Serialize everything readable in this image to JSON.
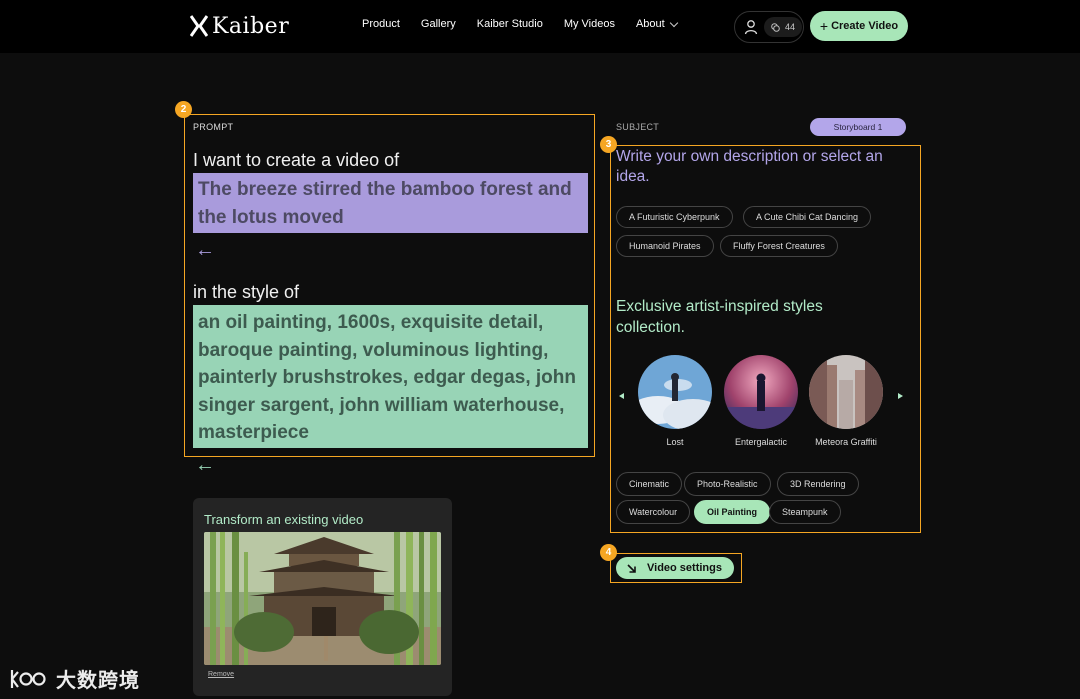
{
  "nav": {
    "brand": "Kaiber",
    "links": [
      "Product",
      "Gallery",
      "Kaiber Studio",
      "My Videos",
      "About"
    ],
    "credits": "44",
    "create_label": "Create Video"
  },
  "annotations": [
    "2",
    "3",
    "4"
  ],
  "prompt": {
    "label": "PROMPT",
    "lead": "I want to create a video of",
    "subject_text": "The breeze stirred the bamboo forest and the lotus moved",
    "style_lead": "in the style of",
    "style_text": "an oil painting, 1600s, exquisite detail, baroque painting, voluminous lighting, painterly brushstrokes, edgar degas, john singer sargent, john william waterhouse, masterpiece"
  },
  "transform": {
    "title": "Transform an existing video",
    "remove_label": "Remove"
  },
  "subject": {
    "label": "SUBJECT",
    "storyboard_label": "Storyboard 1",
    "description": "Write your own description or select an idea.",
    "ideas": [
      "A Futuristic Cyberpunk",
      "A Cute Chibi Cat Dancing",
      "Humanoid Pirates",
      "Fluffy Forest Creatures"
    ]
  },
  "styles": {
    "heading": "Exclusive artist-inspired styles collection.",
    "featured": [
      "Lost",
      "Entergalactic",
      "Meteora Graffiti"
    ],
    "tags": [
      "Cinematic",
      "Photo-Realistic",
      "3D Rendering",
      "Watercolour",
      "Oil Painting",
      "Steampunk"
    ],
    "selected": "Oil Painting"
  },
  "settings": {
    "label": "Video settings"
  },
  "watermark": {
    "text": "大数跨境"
  },
  "colors": {
    "accent_green": "#a8e6b8",
    "accent_purple": "#b3a6ea",
    "annotation_orange": "#f5a623"
  }
}
